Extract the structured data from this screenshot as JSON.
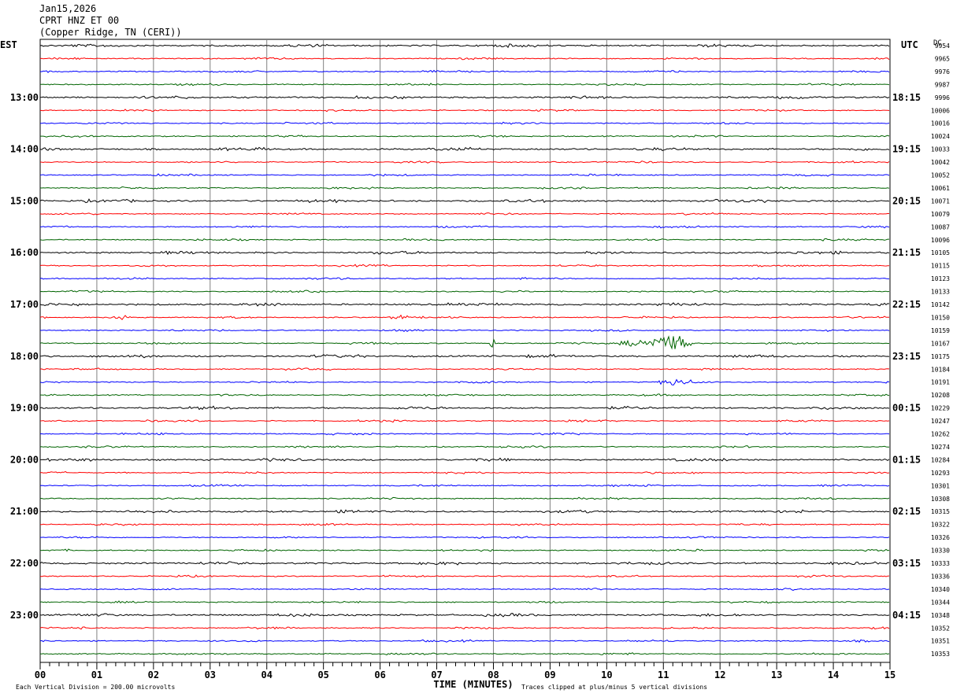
{
  "header": {
    "date": "Jan15,2026",
    "station": "CPRT HNZ ET 00",
    "location": "(Copper Ridge, TN (CERI))"
  },
  "labels": {
    "left_zone": "EST",
    "right_zone": "UTC",
    "dc": "DC",
    "xlabel": "TIME (MINUTES)",
    "scale_note": "Each Vertical Division =  200.00 microvolts",
    "clip_note": "Traces clipped at plus/minus 5 vertical divisions"
  },
  "colors": {
    "trace_cycle": [
      "#000000",
      "#ff0000",
      "#0000ff",
      "#006400"
    ],
    "grid": "#808080"
  },
  "chart_data": {
    "type": "line",
    "title": "CPRT HNZ ET 00",
    "xlabel": "TIME (MINUTES)",
    "xlim": [
      0,
      15
    ],
    "x_ticks": [
      "00",
      "01",
      "02",
      "03",
      "04",
      "05",
      "06",
      "07",
      "08",
      "09",
      "10",
      "11",
      "12",
      "13",
      "14",
      "15"
    ],
    "rows": 48,
    "row_minutes": 15,
    "left_time_labels": [
      {
        "row": 4,
        "label": "13:00"
      },
      {
        "row": 8,
        "label": "14:00"
      },
      {
        "row": 12,
        "label": "15:00"
      },
      {
        "row": 16,
        "label": "16:00"
      },
      {
        "row": 20,
        "label": "17:00"
      },
      {
        "row": 24,
        "label": "18:00"
      },
      {
        "row": 28,
        "label": "19:00"
      },
      {
        "row": 32,
        "label": "20:00"
      },
      {
        "row": 36,
        "label": "21:00"
      },
      {
        "row": 40,
        "label": "22:00"
      },
      {
        "row": 44,
        "label": "23:00"
      }
    ],
    "right_time_labels": [
      {
        "row": 4,
        "label": "18:15"
      },
      {
        "row": 8,
        "label": "19:15"
      },
      {
        "row": 12,
        "label": "20:15"
      },
      {
        "row": 16,
        "label": "21:15"
      },
      {
        "row": 20,
        "label": "22:15"
      },
      {
        "row": 24,
        "label": "23:15"
      },
      {
        "row": 28,
        "label": "00:15"
      },
      {
        "row": 32,
        "label": "01:15"
      },
      {
        "row": 36,
        "label": "02:15"
      },
      {
        "row": 40,
        "label": "03:15"
      },
      {
        "row": 44,
        "label": "04:15"
      }
    ],
    "dc_values": [
      "9954",
      "9965",
      "9976",
      "9987",
      "9996",
      "10006",
      "10016",
      "10024",
      "10033",
      "10042",
      "10052",
      "10061",
      "10071",
      "10079",
      "10087",
      "10096",
      "10105",
      "10115",
      "10123",
      "10133",
      "10142",
      "10150",
      "10159",
      "10167",
      "10175",
      "10184",
      "10191",
      "10208",
      "10229",
      "10247",
      "10262",
      "10274",
      "10284",
      "10293",
      "10301",
      "10308",
      "10315",
      "10322",
      "10326",
      "10330",
      "10333",
      "10336",
      "10340",
      "10344",
      "10348",
      "10352",
      "10351",
      "10353"
    ],
    "events": [
      {
        "row": 23,
        "minute_start": 10.2,
        "minute_end": 11.5,
        "peak_minute": 11.25,
        "amplitude": 0.9
      },
      {
        "row": 23,
        "minute_start": 7.95,
        "minute_end": 8.05,
        "peak_minute": 8.0,
        "amplitude": 0.6
      },
      {
        "row": 26,
        "minute_start": 10.9,
        "minute_end": 11.5,
        "peak_minute": 11.2,
        "amplitude": 0.35
      },
      {
        "row": 21,
        "minute_start": 1.2,
        "minute_end": 1.6,
        "peak_minute": 1.4,
        "amplitude": 0.25
      },
      {
        "row": 21,
        "minute_start": 6.2,
        "minute_end": 6.5,
        "peak_minute": 6.35,
        "amplitude": 0.25
      }
    ]
  }
}
